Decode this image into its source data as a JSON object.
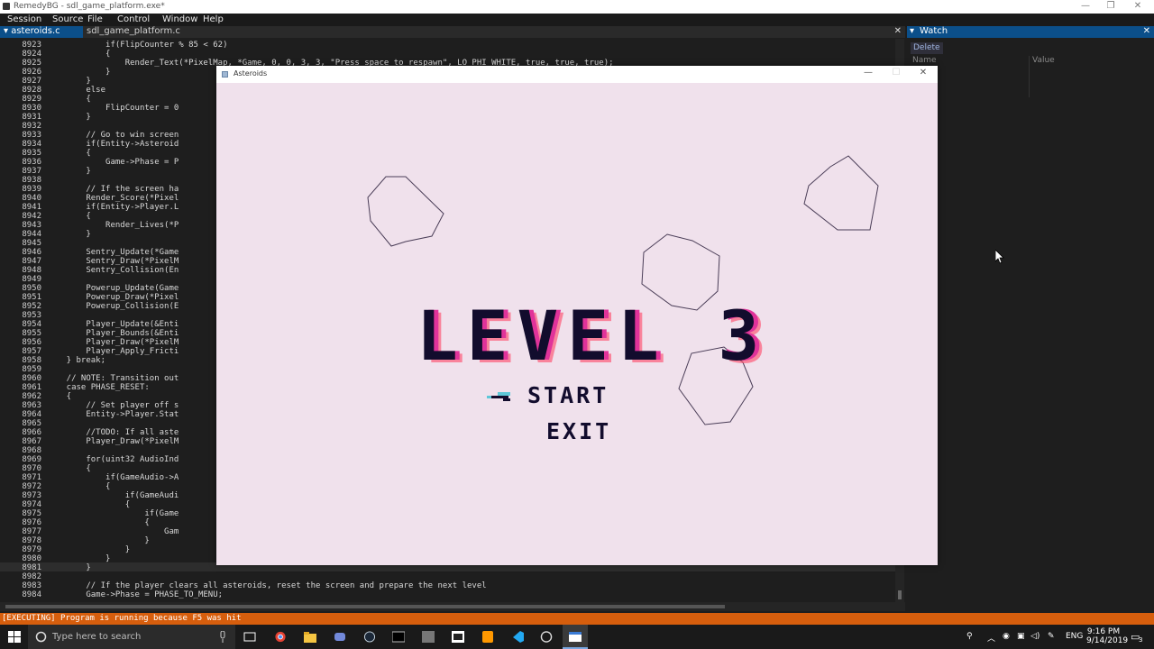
{
  "window": {
    "title": "RemedyBG - sdl_game_platform.exe*"
  },
  "menu": [
    "Session",
    "Source",
    "File",
    "Control",
    "Window",
    "Help"
  ],
  "tabs": [
    {
      "label": "asteroids.c",
      "active": true
    },
    {
      "label": "sdl_game_platform.c",
      "active": false
    }
  ],
  "watch": {
    "title": "Watch",
    "delete_label": "Delete",
    "col_name": "Name",
    "col_value": "Value"
  },
  "code_lines": [
    {
      "n": "8923",
      "t": "            if(FlipCounter % 85 < 62)"
    },
    {
      "n": "8924",
      "t": "            {"
    },
    {
      "n": "8925",
      "t": "                Render_Text(*PixelMap, *Game, 0, 0, 3, 3, \"Press space to respawn\", LO_PHI_WHITE, true, true, true);"
    },
    {
      "n": "8926",
      "t": "            }"
    },
    {
      "n": "8927",
      "t": "        }"
    },
    {
      "n": "8928",
      "t": "        else"
    },
    {
      "n": "8929",
      "t": "        {"
    },
    {
      "n": "8930",
      "t": "            FlipCounter = 0"
    },
    {
      "n": "8931",
      "t": "        }"
    },
    {
      "n": "8932",
      "t": ""
    },
    {
      "n": "8933",
      "t": "        // Go to win screen"
    },
    {
      "n": "8934",
      "t": "        if(Entity->Asteroid"
    },
    {
      "n": "8935",
      "t": "        {"
    },
    {
      "n": "8936",
      "t": "            Game->Phase = P"
    },
    {
      "n": "8937",
      "t": "        }"
    },
    {
      "n": "8938",
      "t": ""
    },
    {
      "n": "8939",
      "t": "        // If the screen ha"
    },
    {
      "n": "8940",
      "t": "        Render_Score(*Pixel"
    },
    {
      "n": "8941",
      "t": "        if(Entity->Player.L"
    },
    {
      "n": "8942",
      "t": "        {"
    },
    {
      "n": "8943",
      "t": "            Render_Lives(*P"
    },
    {
      "n": "8944",
      "t": "        }"
    },
    {
      "n": "8945",
      "t": ""
    },
    {
      "n": "8946",
      "t": "        Sentry_Update(*Game"
    },
    {
      "n": "8947",
      "t": "        Sentry_Draw(*PixelM"
    },
    {
      "n": "8948",
      "t": "        Sentry_Collision(En"
    },
    {
      "n": "8949",
      "t": ""
    },
    {
      "n": "8950",
      "t": "        Powerup_Update(Game"
    },
    {
      "n": "8951",
      "t": "        Powerup_Draw(*Pixel"
    },
    {
      "n": "8952",
      "t": "        Powerup_Collision(E"
    },
    {
      "n": "8953",
      "t": ""
    },
    {
      "n": "8954",
      "t": "        Player_Update(&Enti"
    },
    {
      "n": "8955",
      "t": "        Player_Bounds(&Enti"
    },
    {
      "n": "8956",
      "t": "        Player_Draw(*PixelM"
    },
    {
      "n": "8957",
      "t": "        Player_Apply_Fricti"
    },
    {
      "n": "8958",
      "t": "    } break;"
    },
    {
      "n": "8959",
      "t": ""
    },
    {
      "n": "8960",
      "t": "    // NOTE: Transition out"
    },
    {
      "n": "8961",
      "t": "    case PHASE_RESET:"
    },
    {
      "n": "8962",
      "t": "    {"
    },
    {
      "n": "8963",
      "t": "        // Set player off s"
    },
    {
      "n": "8964",
      "t": "        Entity->Player.Stat"
    },
    {
      "n": "8965",
      "t": ""
    },
    {
      "n": "8966",
      "t": "        //TODO: If all aste"
    },
    {
      "n": "8967",
      "t": "        Player_Draw(*PixelM"
    },
    {
      "n": "8968",
      "t": ""
    },
    {
      "n": "8969",
      "t": "        for(uint32 AudioInd"
    },
    {
      "n": "8970",
      "t": "        {"
    },
    {
      "n": "8971",
      "t": "            if(GameAudio->A"
    },
    {
      "n": "8972",
      "t": "            {"
    },
    {
      "n": "8973",
      "t": "                if(GameAudi"
    },
    {
      "n": "8974",
      "t": "                {"
    },
    {
      "n": "8975",
      "t": "                    if(Game"
    },
    {
      "n": "8976",
      "t": "                    {"
    },
    {
      "n": "8977",
      "t": "                        Gam"
    },
    {
      "n": "8978",
      "t": "                    }"
    },
    {
      "n": "8979",
      "t": "                }"
    },
    {
      "n": "8980",
      "t": "            }"
    },
    {
      "n": "8981",
      "t": "        }"
    },
    {
      "n": "8982",
      "t": ""
    },
    {
      "n": "8983",
      "t": "        // If the player clears all asteroids, reset the screen and prepare the next level"
    },
    {
      "n": "8984",
      "t": "        Game->Phase = PHASE_TO_MENU;"
    }
  ],
  "game": {
    "title": "Asteroids",
    "level_text": "LEVEL 3",
    "start_label": "START",
    "exit_label": "EXIT",
    "colors": {
      "bg": "#f0e1ec",
      "ink": "#120c2d",
      "accent_pink": "#e0339a",
      "accent_red": "#ff4466"
    }
  },
  "status": "[EXECUTING] Program is running because F5 was hit",
  "taskbar": {
    "search_placeholder": "Type here to search",
    "lang": "ENG",
    "time": "9:16 PM",
    "date": "9/14/2019",
    "notif_count": "3"
  }
}
